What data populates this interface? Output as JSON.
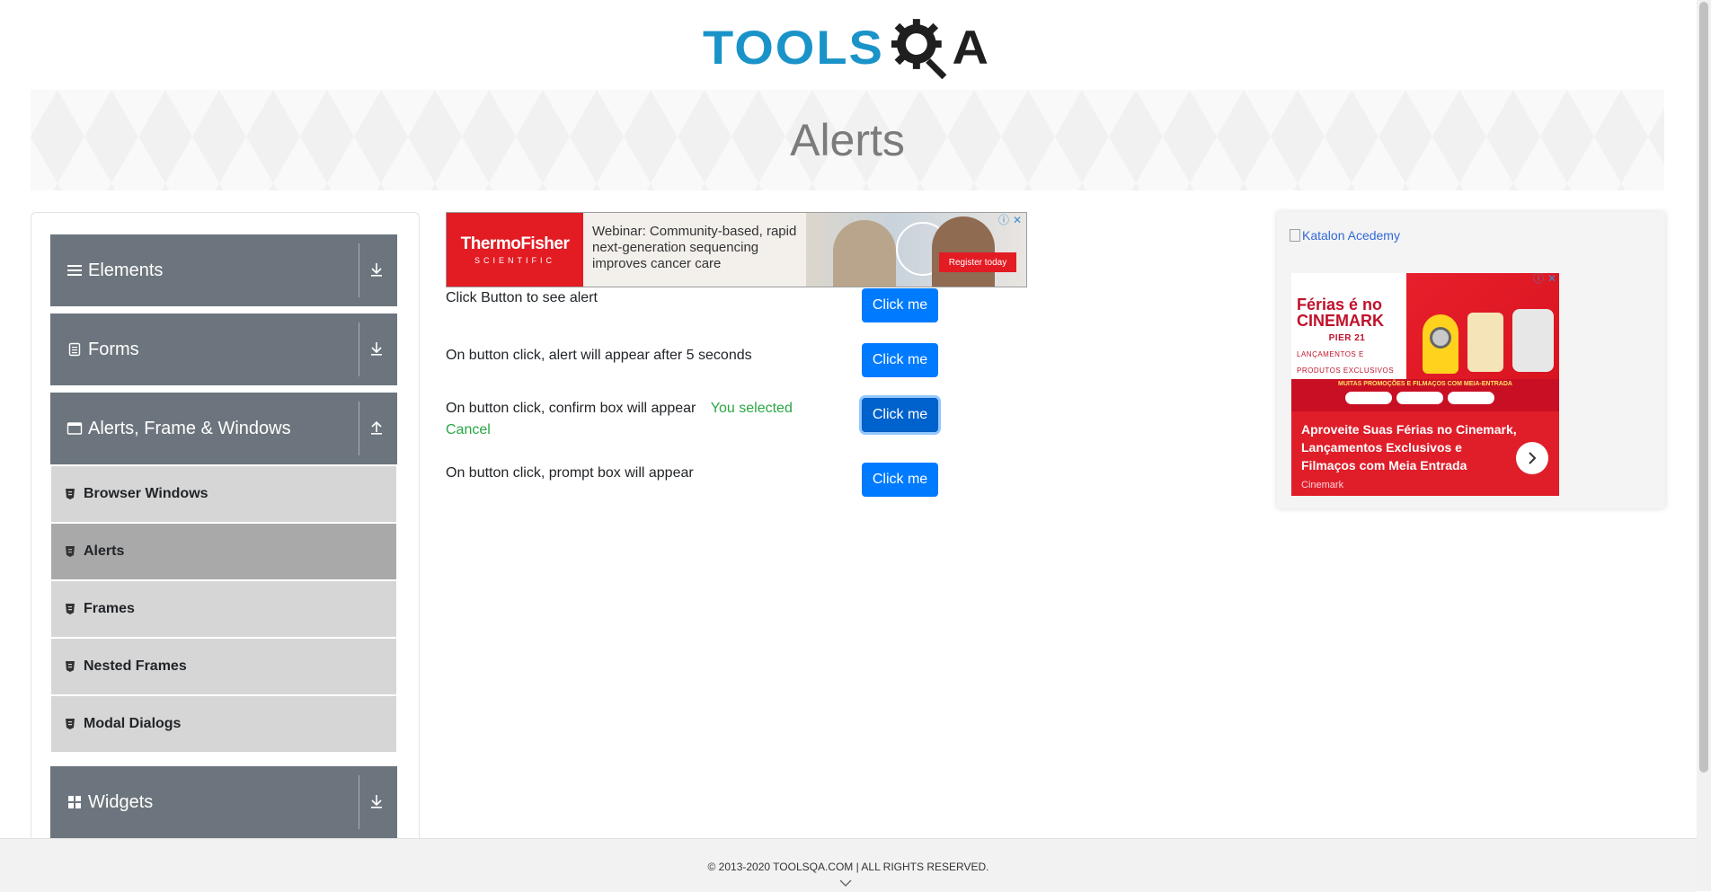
{
  "header": {
    "logo_tools": "TOOLS",
    "logo_q": "Q",
    "logo_a": "A",
    "page_title": "Alerts"
  },
  "sidebar": {
    "groups": [
      {
        "label": "Elements",
        "icon": "hamburger-icon",
        "state": "collapsed"
      },
      {
        "label": "Forms",
        "icon": "document-icon",
        "state": "collapsed"
      },
      {
        "label": "Alerts, Frame & Windows",
        "icon": "window-icon",
        "state": "expanded"
      },
      {
        "label": "Widgets",
        "icon": "grid-icon",
        "state": "collapsed"
      }
    ],
    "items": [
      {
        "label": "Browser Windows",
        "active": false
      },
      {
        "label": "Alerts",
        "active": true
      },
      {
        "label": "Frames",
        "active": false
      },
      {
        "label": "Nested Frames",
        "active": false
      },
      {
        "label": "Modal Dialogs",
        "active": false
      }
    ]
  },
  "ad_top": {
    "brand_line1": "ThermoFisher",
    "brand_line2": "SCIENTIFIC",
    "copy": "Webinar: Community-based, rapid next-generation sequencing improves cancer care",
    "cta": "Register today"
  },
  "main": {
    "rows": [
      {
        "label": "Click Button to see alert",
        "button": "Click me"
      },
      {
        "label": "On button click, alert will appear after 5 seconds",
        "button": "Click me"
      },
      {
        "label": "On button click, confirm box will appear",
        "result": "You selected Cancel",
        "button": "Click me"
      },
      {
        "label": "On button click, prompt box will appear",
        "button": "Click me"
      }
    ]
  },
  "right_ad": {
    "katalon_alt": "Katalon Acedemy",
    "cinema_logo": "Férias é no CINEMARK",
    "cinema_location": "PIER 21",
    "cinema_sub": "LANÇAMENTOS E PRODUTOS EXCLUSIVOS",
    "strip_title": "MUITAS PROMOÇÕES E FILMAÇOS COM MEIA-ENTRADA",
    "headline": "Aproveite Suas Férias no Cinemark, Lançamentos Exclusivos e Filmaços com Meia Entrada",
    "brand": "Cinemark"
  },
  "footer": {
    "text": "© 2013-2020 TOOLSQA.COM | ALL RIGHTS RESERVED."
  },
  "colors": {
    "sidebar_header": "#6c757d",
    "sidebar_item": "#d6d6d6",
    "sidebar_item_active": "#a9a9a9",
    "button": "#007bff",
    "result_text": "#28a745",
    "logo_blue": "#1a93c9"
  }
}
